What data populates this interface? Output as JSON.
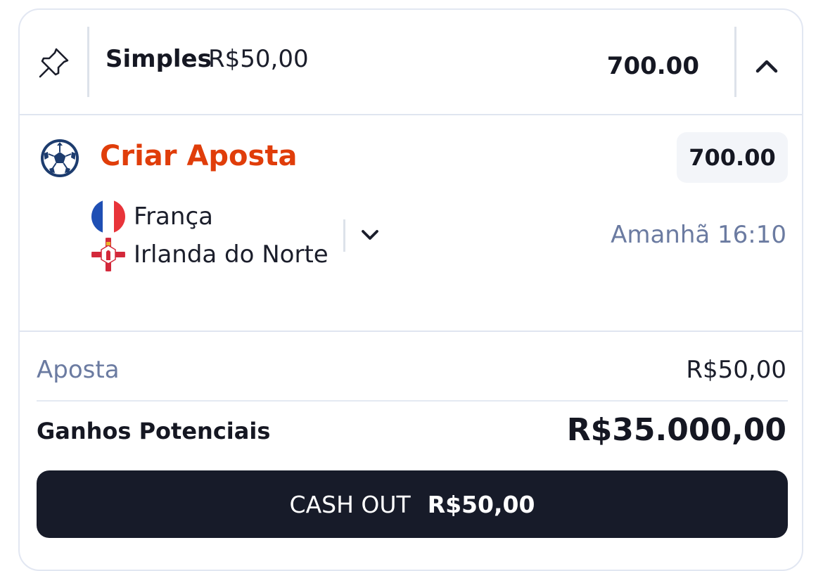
{
  "header": {
    "bet_type": "Simples",
    "stake": "R$50,00",
    "total_odds": "700.00",
    "pin_icon": "pin-icon",
    "collapse_icon": "chevron-up-icon"
  },
  "selection": {
    "sport_icon": "soccer-ball-icon",
    "market": "Criar Aposta",
    "odds": "700.00",
    "home_team": "França",
    "away_team": "Irlanda do Norte",
    "expand_icon": "chevron-down-icon",
    "start_time": "Amanhã 16:10"
  },
  "summary": {
    "stake_label": "Aposta",
    "stake_value": "R$50,00",
    "winnings_label": "Ganhos Potenciais",
    "winnings_value": "R$35.000,00"
  },
  "cashout": {
    "label": "CASH OUT",
    "amount": "R$50,00"
  },
  "colors": {
    "accent": "#e03d0a",
    "muted_text": "#6b7ba1",
    "button_bg": "#171b29",
    "border": "#e2e7f2"
  }
}
